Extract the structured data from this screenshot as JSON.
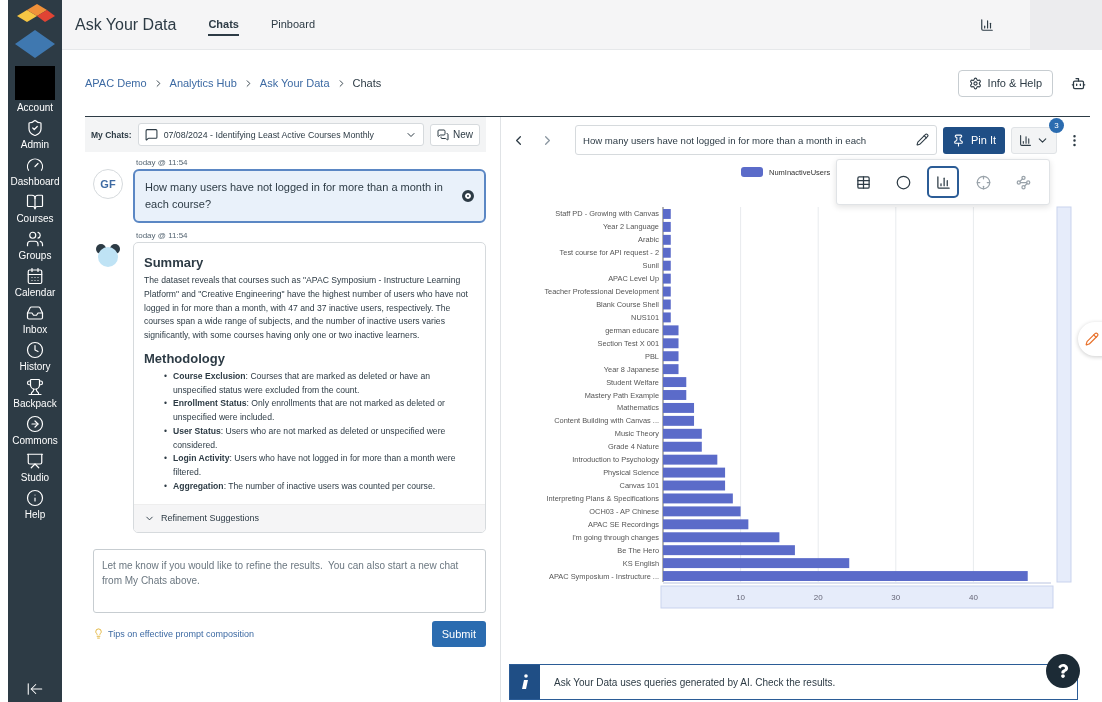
{
  "app": {
    "title": "Ask Your Data",
    "tabs": [
      {
        "label": "Chats",
        "selected": true
      },
      {
        "label": "Pinboard",
        "selected": false
      }
    ]
  },
  "sidebar": {
    "items": [
      {
        "kind": "account",
        "label": "Account"
      },
      {
        "kind": "admin",
        "label": "Admin"
      },
      {
        "kind": "dashboard",
        "label": "Dashboard"
      },
      {
        "kind": "courses",
        "label": "Courses"
      },
      {
        "kind": "groups",
        "label": "Groups"
      },
      {
        "kind": "calendar",
        "label": "Calendar"
      },
      {
        "kind": "inbox",
        "label": "Inbox"
      },
      {
        "kind": "history",
        "label": "History"
      },
      {
        "kind": "backpack",
        "label": "Backpack"
      },
      {
        "kind": "commons",
        "label": "Commons"
      },
      {
        "kind": "studio",
        "label": "Studio"
      },
      {
        "kind": "help",
        "label": "Help"
      }
    ]
  },
  "breadcrumb": [
    "APAC Demo",
    "Analytics Hub",
    "Ask Your Data",
    "Chats"
  ],
  "help_button": "Info & Help",
  "chats": {
    "label": "My Chats:",
    "current": "07/08/2024 - Identifying Least Active Courses Monthly",
    "new_button": "New"
  },
  "messages": [
    {
      "kind": "user",
      "time": "today @ 11:54",
      "avatar": "GF",
      "text": "How many users have not logged in for more than a month in each course?"
    },
    {
      "kind": "bot",
      "time": "today @ 11:54",
      "sections": [
        {
          "heading": "Summary",
          "paragraph": "The dataset reveals that courses such as \"APAC Symposium - Instructure Learning Platform\" and \"Creative Engineering\" have the highest number of users who have not logged in for more than a month, with 47 and 37 inactive users, respectively. The courses span a wide range of subjects, and the number of inactive users varies significantly, with some courses having only one or two inactive learners."
        },
        {
          "heading": "Methodology",
          "bullet": "•",
          "bullets": [
            "**Course Exclusion**: Courses that are marked as deleted or have an unspecified status were excluded from the count.",
            "**Enrollment Status**: Only enrollments that are not marked as deleted or unspecified were included.",
            "**User Status**: Users who are not marked as deleted or unspecified were considered.",
            "**Login Activity**: Users who have not logged in for more than a month were filtered.",
            "**Aggregation**: The number of inactive users was counted per course."
          ]
        }
      ],
      "footer": {
        "label": "Refinement Suggestions",
        "expanded": false
      }
    }
  ],
  "composer": {
    "placeholder": "Let me know if you would like to refine the results.  You can also start a new chat from My Chats above.",
    "tip": "Tips on effective prompt composition",
    "submit": "Submit"
  },
  "query": {
    "value": "How many users have not logged in for more than a month in each",
    "pin_button": "Pin It",
    "badge": "3"
  },
  "chart_types": [
    {
      "kind": "table",
      "selected": false
    },
    {
      "kind": "pie",
      "selected": false
    },
    {
      "kind": "bar",
      "selected": true
    },
    {
      "kind": "radar",
      "selected": false
    },
    {
      "kind": "scatter",
      "selected": false
    }
  ],
  "chart_data": {
    "type": "bar",
    "orientation": "horizontal",
    "categories": [
      "Staff PD - Growing with Canvas",
      "Year 2 Language",
      "Arabic",
      "Test course for API request - 2",
      "Sunil",
      "APAC Level Up",
      "Teacher Professional Development",
      "Blank Course Shell",
      "NUS101",
      "german educare",
      "Section Test X 001",
      "PBL",
      "Year 8 Japanese",
      "Student Welfare",
      "Mastery Path Example",
      "Mathematics",
      "Content Building with Canvas ...",
      "Music Theory",
      "Grade 4 Nature",
      "Introduction to Psychology",
      "Physical Science",
      "Canvas 101",
      "Interpreting Plans & Specifications",
      "OCH03 - AP Chinese",
      "APAC SE Recordings",
      "I'm going through changes",
      "Be The Hero",
      "KS English",
      "APAC Symposium - Instructure ..."
    ],
    "series": [
      {
        "name": "NumInactiveUsers",
        "color": "#5b6bc9",
        "values": [
          1,
          1,
          1,
          1,
          1,
          1,
          1,
          1,
          1,
          2,
          2,
          2,
          2,
          3,
          3,
          4,
          4,
          5,
          5,
          7,
          8,
          8,
          9,
          10,
          11,
          15,
          17,
          24,
          47
        ]
      }
    ],
    "xlim": [
      0,
      50
    ],
    "xticks": [
      10,
      20,
      30,
      40
    ],
    "grid": true
  },
  "notice": "Ask Your Data uses queries generated by AI. Check the results."
}
